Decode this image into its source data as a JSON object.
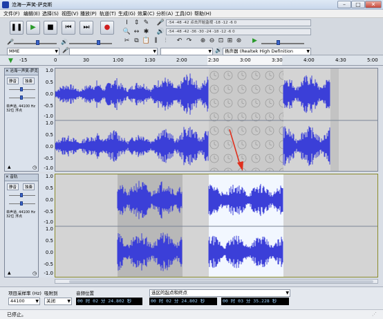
{
  "window": {
    "title": "沧海一声笑-萨克斯"
  },
  "menu": [
    "文件(F)",
    "编辑(E)",
    "选择(S)",
    "视图(V)",
    "播放(P)",
    "轨道(T)",
    "生成(G)",
    "效果(C)",
    "分析(A)",
    "工具(O)",
    "帮助(H)"
  ],
  "meter": {
    "record_scale": "-54   -48   -42   -36   -30   -24   -18   -12    -6    0",
    "record_hint": "-54  -48  -42   点击开始监视   -18  -12   -6   0",
    "play_scale": "-54   -48   -42   -36   -30   -24   -18   -12    -6    0"
  },
  "device": {
    "host": "MME",
    "output": "扬声器 (Realtek High Definition"
  },
  "ruler": {
    "labels": [
      "-15",
      "0",
      "30",
      "1:00",
      "1:30",
      "2:00",
      "2:30",
      "3:00",
      "3:30",
      "4:00",
      "4:30",
      "5:00"
    ]
  },
  "tracks": [
    {
      "name": "沧海一声笑-萨克",
      "mute": "静音",
      "solo": "独奏",
      "info": "单声道, 44100 Hz\n32位 浮点"
    },
    {
      "name": "音轨",
      "mute": "静音",
      "solo": "独奏",
      "info": "单声道, 44100 Hz\n32位 浮点"
    }
  ],
  "scale_labels": [
    "1.0",
    "0.5",
    "0.0",
    "-0.5",
    "-1.0"
  ],
  "bottom": {
    "rate_label": "项目采样率 (Hz)",
    "rate_value": "44100",
    "snap_label": "吸附到",
    "snap_value": "关闭",
    "audio_pos_label": "音频位置",
    "audio_pos_value": "00 时 02 分 24.802 秒",
    "sel_label": "选区的起点和终点",
    "sel_start": "00 时 02 分 24.802 秒",
    "sel_end": "00 时 03 分 35.228 秒"
  },
  "status": {
    "text": "已停止。"
  },
  "colors": {
    "wave": "#3b3fd8",
    "selection": "#ffffff",
    "accent": "#1f3d8a",
    "arrow": "#e0301e"
  }
}
